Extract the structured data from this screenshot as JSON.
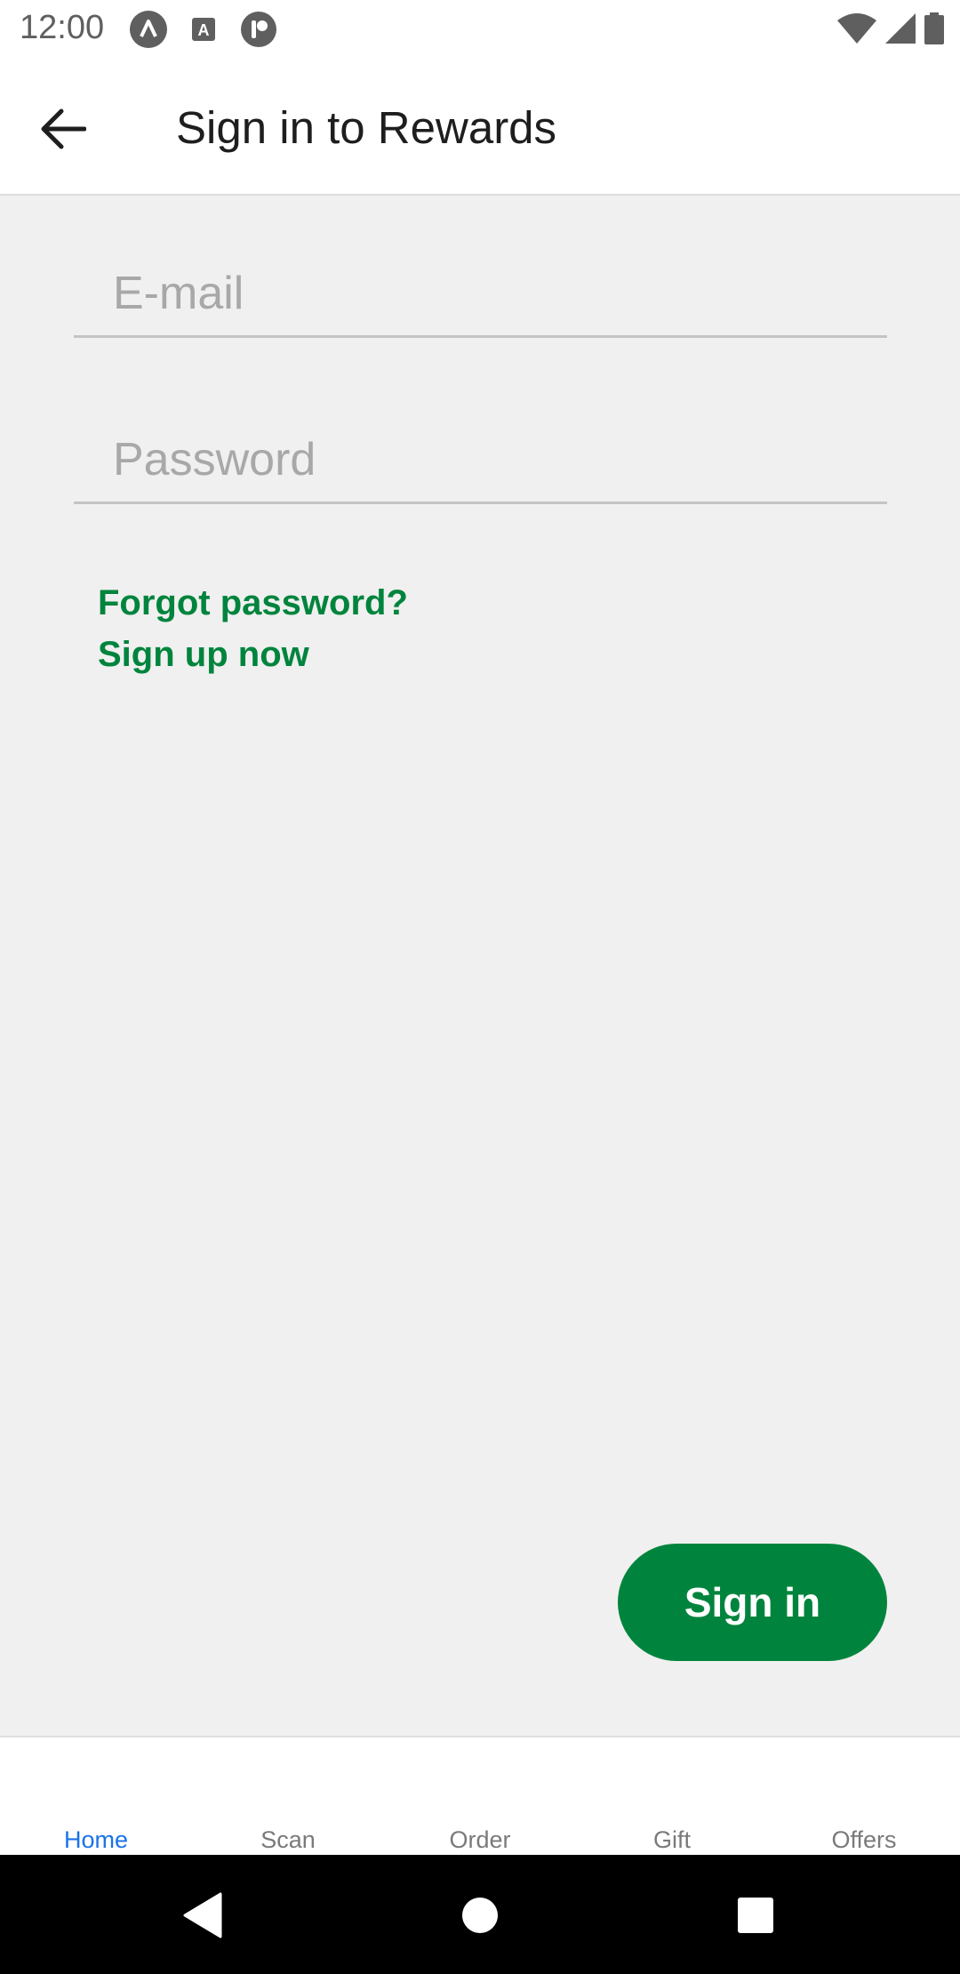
{
  "status_bar": {
    "time": "12:00",
    "icons": [
      "arrow-app-icon",
      "a-notification-icon",
      "p-notification-icon",
      "wifi-icon",
      "cell-signal-icon",
      "battery-icon"
    ]
  },
  "app_bar": {
    "back_icon": "arrow-left-icon",
    "title": "Sign in to Rewards"
  },
  "form": {
    "email_placeholder": "E-mail",
    "email_value": "",
    "password_placeholder": "Password",
    "password_value": "",
    "forgot_password_label": "Forgot password?",
    "sign_up_label": "Sign up now",
    "sign_in_label": "Sign in"
  },
  "bottom_nav": {
    "items": [
      {
        "label": "Home",
        "active": true
      },
      {
        "label": "Scan",
        "active": false
      },
      {
        "label": "Order",
        "active": false
      },
      {
        "label": "Gift",
        "active": false
      },
      {
        "label": "Offers",
        "active": false
      }
    ]
  },
  "colors": {
    "brand_green": "#00843d",
    "active_nav_blue": "#1a73e8",
    "content_bg": "#f0f0f0"
  }
}
